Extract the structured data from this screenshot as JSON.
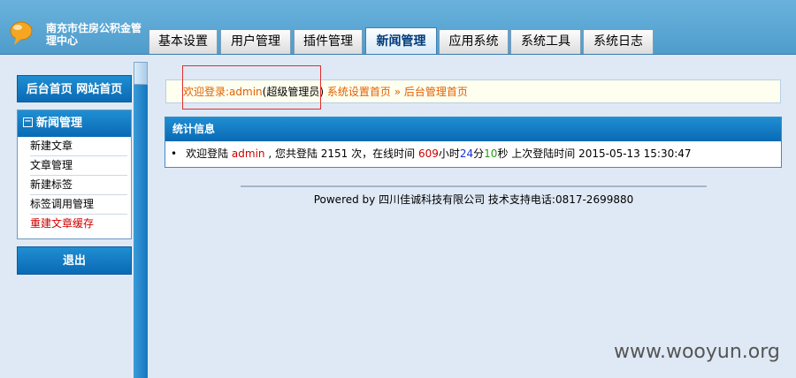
{
  "header": {
    "org_name": "南充市住房公积金管理中心",
    "tabs": [
      {
        "label": "基本设置",
        "active": false
      },
      {
        "label": "用户管理",
        "active": false
      },
      {
        "label": "插件管理",
        "active": false
      },
      {
        "label": "新闻管理",
        "active": true
      },
      {
        "label": "应用系统",
        "active": false
      },
      {
        "label": "系统工具",
        "active": false
      },
      {
        "label": "系统日志",
        "active": false
      }
    ]
  },
  "sidebar": {
    "top_links": "后台首页 网站首页",
    "section_title": "新闻管理",
    "items": [
      {
        "label": "新建文章"
      },
      {
        "label": "文章管理"
      },
      {
        "label": "新建标签"
      },
      {
        "label": "标签调用管理"
      },
      {
        "label": "重建文章缓存"
      }
    ],
    "logout": "退出"
  },
  "welcome": {
    "prefix": "欢迎登录:",
    "user": "admin",
    "role": "(超级管理员)",
    "link1": "系统设置首页",
    "sep": " » ",
    "link2": "后台管理首页"
  },
  "stats": {
    "title": "统计信息",
    "bullet": "•",
    "t1": "欢迎登陆 ",
    "user": "admin",
    "t2": " , 您共登陆 2151 次，在线时间 ",
    "hours": "609",
    "t3": "小时",
    "minutes": "24",
    "t4": "分",
    "seconds": "10",
    "t5": "秒 上次登陆时间 2015-05-13 15:30:47"
  },
  "footer": {
    "text": "Powered by 四川佳诚科技有限公司  技术支持电话:0817-2699880"
  },
  "watermark": "www.wooyun.org",
  "colors": {
    "header": "#5aa6d6",
    "nav_blue": "#1579c2",
    "background": "#dfe9f5",
    "accent_red": "#cc0000",
    "welcome_orange": "#e06000"
  }
}
